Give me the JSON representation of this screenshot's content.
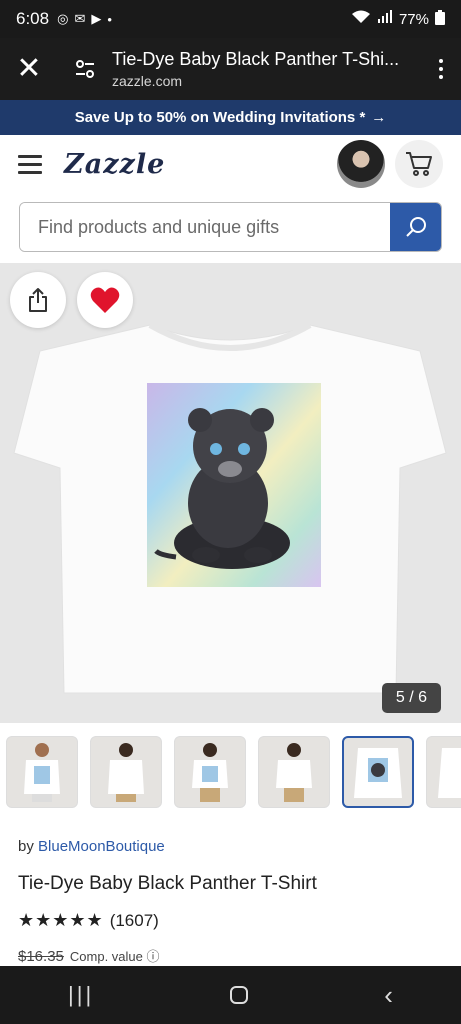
{
  "status_bar": {
    "time": "6:08",
    "battery": "77%"
  },
  "browser": {
    "title": "Tie-Dye Baby Black Panther T-Shi...",
    "url": "zazzle.com"
  },
  "promo": {
    "text": "Save Up to 50% on Wedding Invitations *",
    "arrow": "→"
  },
  "header": {
    "logo": "Zazzle"
  },
  "search": {
    "placeholder": "Find products and unique gifts"
  },
  "gallery": {
    "counter": "5 / 6",
    "selected_index": 5
  },
  "product": {
    "by_prefix": "by",
    "seller": "BlueMoonBoutique",
    "title": "Tie-Dye Baby Black Panther T-Shirt",
    "stars": "★★★★★",
    "rating_value": 5,
    "review_count": "(1607)",
    "old_price": "$16.35",
    "comp_label": "Comp. value ⓘ"
  },
  "colors": {
    "promo_bg": "#1f3a6b",
    "accent_blue": "#2d5aa8",
    "favorite_red": "#e0142c"
  }
}
